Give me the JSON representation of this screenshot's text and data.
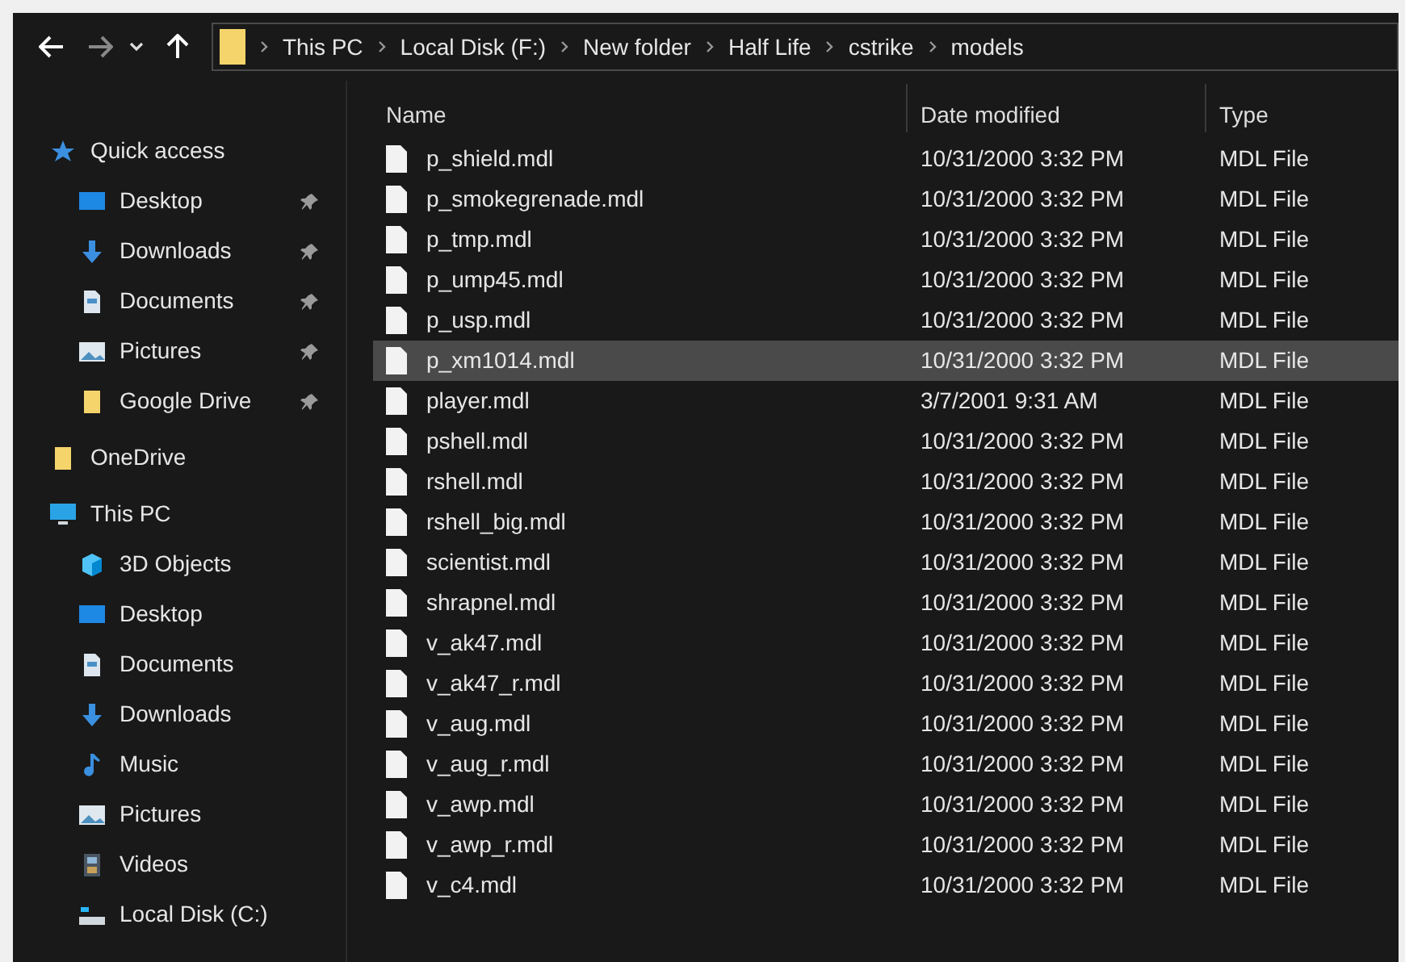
{
  "address_bar": {
    "breadcrumbs": [
      "This PC",
      "Local Disk (F:)",
      "New folder",
      "Half Life",
      "cstrike",
      "models"
    ]
  },
  "sidebar": {
    "items": [
      {
        "label": "Quick access",
        "pinned": false,
        "kind": "section"
      },
      {
        "label": "Desktop",
        "pinned": true,
        "kind": "child"
      },
      {
        "label": "Downloads",
        "pinned": true,
        "kind": "child"
      },
      {
        "label": "Documents",
        "pinned": true,
        "kind": "child"
      },
      {
        "label": "Pictures",
        "pinned": true,
        "kind": "child"
      },
      {
        "label": "Google Drive",
        "pinned": true,
        "kind": "child"
      },
      {
        "label": "OneDrive",
        "pinned": false,
        "kind": "section"
      },
      {
        "label": "This PC",
        "pinned": false,
        "kind": "section"
      },
      {
        "label": "3D Objects",
        "pinned": false,
        "kind": "child"
      },
      {
        "label": "Desktop",
        "pinned": false,
        "kind": "child"
      },
      {
        "label": "Documents",
        "pinned": false,
        "kind": "child"
      },
      {
        "label": "Downloads",
        "pinned": false,
        "kind": "child"
      },
      {
        "label": "Music",
        "pinned": false,
        "kind": "child"
      },
      {
        "label": "Pictures",
        "pinned": false,
        "kind": "child"
      },
      {
        "label": "Videos",
        "pinned": false,
        "kind": "child"
      },
      {
        "label": "Local Disk (C:)",
        "pinned": false,
        "kind": "child"
      }
    ]
  },
  "table": {
    "columns": [
      "Name",
      "Date modified",
      "Type"
    ],
    "rows": [
      {
        "name": "p_shield.mdl",
        "date": "10/31/2000 3:32 PM",
        "type": "MDL File",
        "selected": false
      },
      {
        "name": "p_smokegrenade.mdl",
        "date": "10/31/2000 3:32 PM",
        "type": "MDL File",
        "selected": false
      },
      {
        "name": "p_tmp.mdl",
        "date": "10/31/2000 3:32 PM",
        "type": "MDL File",
        "selected": false
      },
      {
        "name": "p_ump45.mdl",
        "date": "10/31/2000 3:32 PM",
        "type": "MDL File",
        "selected": false
      },
      {
        "name": "p_usp.mdl",
        "date": "10/31/2000 3:32 PM",
        "type": "MDL File",
        "selected": false
      },
      {
        "name": "p_xm1014.mdl",
        "date": "10/31/2000 3:32 PM",
        "type": "MDL File",
        "selected": true
      },
      {
        "name": "player.mdl",
        "date": "3/7/2001 9:31 AM",
        "type": "MDL File",
        "selected": false
      },
      {
        "name": "pshell.mdl",
        "date": "10/31/2000 3:32 PM",
        "type": "MDL File",
        "selected": false
      },
      {
        "name": "rshell.mdl",
        "date": "10/31/2000 3:32 PM",
        "type": "MDL File",
        "selected": false
      },
      {
        "name": "rshell_big.mdl",
        "date": "10/31/2000 3:32 PM",
        "type": "MDL File",
        "selected": false
      },
      {
        "name": "scientist.mdl",
        "date": "10/31/2000 3:32 PM",
        "type": "MDL File",
        "selected": false
      },
      {
        "name": "shrapnel.mdl",
        "date": "10/31/2000 3:32 PM",
        "type": "MDL File",
        "selected": false
      },
      {
        "name": "v_ak47.mdl",
        "date": "10/31/2000 3:32 PM",
        "type": "MDL File",
        "selected": false
      },
      {
        "name": "v_ak47_r.mdl",
        "date": "10/31/2000 3:32 PM",
        "type": "MDL File",
        "selected": false
      },
      {
        "name": "v_aug.mdl",
        "date": "10/31/2000 3:32 PM",
        "type": "MDL File",
        "selected": false
      },
      {
        "name": "v_aug_r.mdl",
        "date": "10/31/2000 3:32 PM",
        "type": "MDL File",
        "selected": false
      },
      {
        "name": "v_awp.mdl",
        "date": "10/31/2000 3:32 PM",
        "type": "MDL File",
        "selected": false
      },
      {
        "name": "v_awp_r.mdl",
        "date": "10/31/2000 3:32 PM",
        "type": "MDL File",
        "selected": false
      },
      {
        "name": "v_c4.mdl",
        "date": "10/31/2000 3:32 PM",
        "type": "MDL File",
        "selected": false
      }
    ]
  }
}
